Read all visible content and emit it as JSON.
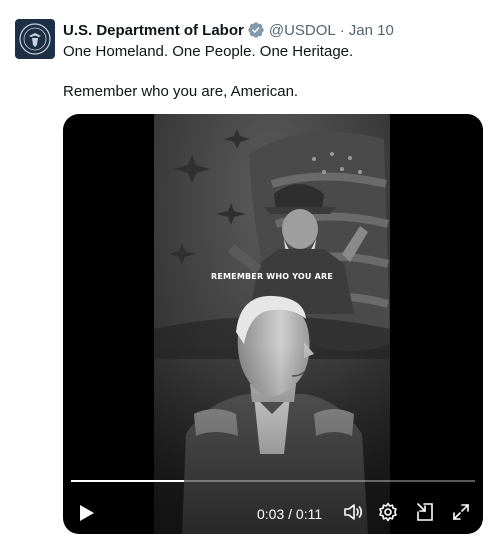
{
  "tweet": {
    "display_name": "U.S. Department of Labor",
    "handle": "@USDOL",
    "separator": "·",
    "date": "Jan 10",
    "text_line1": "One Homeland. One People. One Heritage.",
    "text_line2": "Remember who you are, American."
  },
  "video": {
    "overlay_caption": "REMEMBER WHO YOU ARE",
    "current_time": "0:03",
    "duration": "0:11",
    "time_separator": " / ",
    "progress": 0.28
  },
  "colors": {
    "verified_badge": "#829aab",
    "text_primary": "#0f1419",
    "text_secondary": "#536471",
    "avatar_bg": "#1c2f45"
  },
  "icons": {
    "avatar": "dol-seal-icon",
    "verified": "verified-badge-icon",
    "play": "play-icon",
    "volume": "volume-icon",
    "settings": "gear-icon",
    "dock": "dock-icon",
    "fullscreen": "fullscreen-icon"
  }
}
